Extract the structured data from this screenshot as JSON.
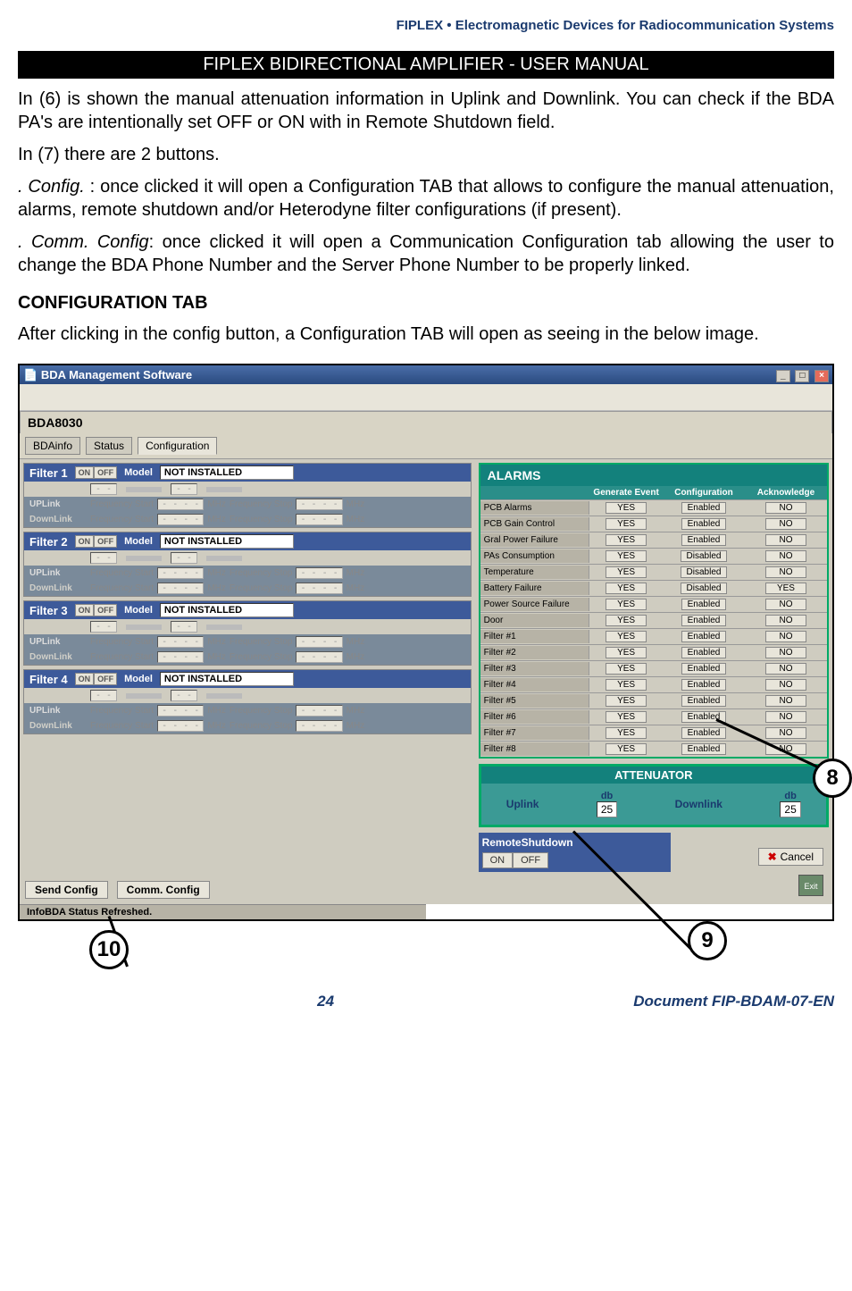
{
  "header": {
    "brand": "FIPLEX • Electromagnetic Devices for Radiocommunication Systems"
  },
  "title_bar": "FIPLEX BIDIRECTIONAL AMPLIFIER -  USER MANUAL",
  "para1": "In (6) is shown the manual attenuation information in Uplink and Downlink.  You can check if the BDA PA's are intentionally set OFF or ON with in Remote Shutdown field.",
  "para2": "In (7) there are 2 buttons.",
  "para3_lead": ". Config.",
  "para3_rest": " : once clicked it will open a Configuration TAB that allows to configure the manual attenuation, alarms, remote shutdown and/or Heterodyne filter configurations (if present).",
  "para4_lead": ". Comm. Config",
  "para4_rest": ": once clicked it will open a Communication Configuration tab allowing the user to change the BDA Phone Number and the Server Phone Number to be properly linked.",
  "section_head": "CONFIGURATION TAB",
  "para5": "After clicking in the config button, a Configuration TAB will open as seeing in the below image.",
  "app": {
    "window_title": "BDA Management Software",
    "device": "BDA8030",
    "tabs": {
      "bdainfo": "BDAinfo",
      "status": "Status",
      "config": "Configuration"
    },
    "filter_labels": {
      "on": "ON",
      "off": "OFF",
      "model": "Model",
      "model_val": "NOT INSTALLED",
      "uplink": "UPLink",
      "downlink": "DownLink",
      "fstart": "Frequency Start",
      "fstop": "Frequency Stop",
      "blank": "- - - -",
      "spin": "- -",
      "mhz": "MHz"
    },
    "filters": [
      "Filter 1",
      "Filter 2",
      "Filter 3",
      "Filter 4"
    ],
    "alarms": {
      "title": "ALARMS",
      "cols": {
        "gen": "Generate Event",
        "conf": "Configuration",
        "ack": "Acknowledge"
      },
      "rows": [
        {
          "name": "PCB Alarms",
          "gen": "YES",
          "conf": "Enabled",
          "ack": "NO"
        },
        {
          "name": "PCB Gain Control",
          "gen": "YES",
          "conf": "Enabled",
          "ack": "NO"
        },
        {
          "name": "Gral Power Failure",
          "gen": "YES",
          "conf": "Enabled",
          "ack": "NO"
        },
        {
          "name": "PAs Consumption",
          "gen": "YES",
          "conf": "Disabled",
          "ack": "NO"
        },
        {
          "name": "Temperature",
          "gen": "YES",
          "conf": "Disabled",
          "ack": "NO"
        },
        {
          "name": "Battery Failure",
          "gen": "YES",
          "conf": "Disabled",
          "ack": "YES"
        },
        {
          "name": "Power Source Failure",
          "gen": "YES",
          "conf": "Enabled",
          "ack": "NO"
        },
        {
          "name": "Door",
          "gen": "YES",
          "conf": "Enabled",
          "ack": "NO"
        },
        {
          "name": "Filter #1",
          "gen": "YES",
          "conf": "Enabled",
          "ack": "NO"
        },
        {
          "name": "Filter #2",
          "gen": "YES",
          "conf": "Enabled",
          "ack": "NO"
        },
        {
          "name": "Filter #3",
          "gen": "YES",
          "conf": "Enabled",
          "ack": "NO"
        },
        {
          "name": "Filter #4",
          "gen": "YES",
          "conf": "Enabled",
          "ack": "NO"
        },
        {
          "name": "Filter #5",
          "gen": "YES",
          "conf": "Enabled",
          "ack": "NO"
        },
        {
          "name": "Filter #6",
          "gen": "YES",
          "conf": "Enabled",
          "ack": "NO"
        },
        {
          "name": "Filter #7",
          "gen": "YES",
          "conf": "Enabled",
          "ack": "NO"
        },
        {
          "name": "Filter #8",
          "gen": "YES",
          "conf": "Enabled",
          "ack": "NO"
        }
      ]
    },
    "attenuator": {
      "title": "ATTENUATOR",
      "uplink_lbl": "Uplink",
      "downlink_lbl": "Downlink",
      "unit": "db",
      "uplink_val": "25",
      "downlink_val": "25"
    },
    "remote": {
      "title": "RemoteShutdown",
      "on": "ON",
      "off": "OFF"
    },
    "cancel": "Cancel",
    "exit": "Exit",
    "footer_btns": {
      "send": "Send Config",
      "comm": "Comm. Config"
    },
    "status_text": "InfoBDA Status Refreshed."
  },
  "callouts": {
    "c8": "8",
    "c9": "9",
    "c10": "10"
  },
  "page_footer": {
    "num": "24",
    "doc": "Document FIP-BDAM-07-EN"
  }
}
